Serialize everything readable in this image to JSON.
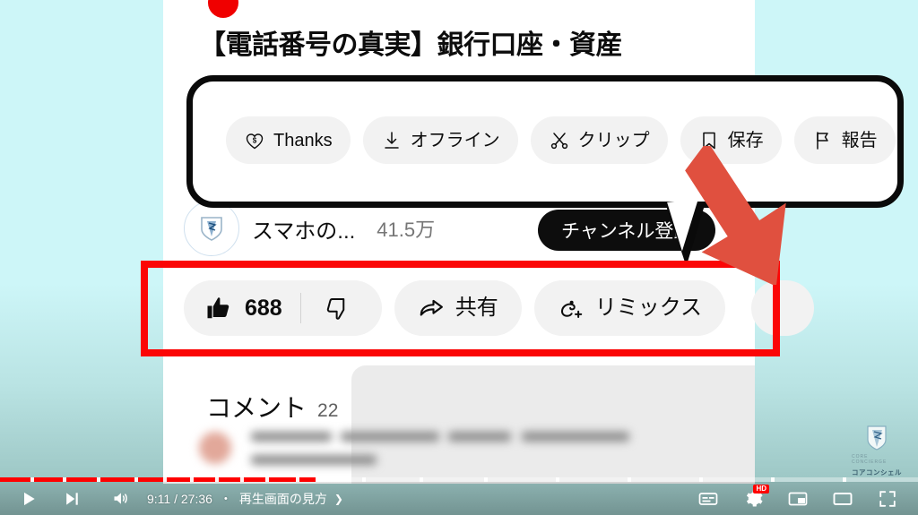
{
  "video": {
    "title": "【電話番号の真実】銀行口座・資産",
    "top_dot_color": "#f00000"
  },
  "action_chips": [
    {
      "label": "Thanks",
      "icon": "heart-dollar-icon"
    },
    {
      "label": "オフライン",
      "icon": "download-icon"
    },
    {
      "label": "クリップ",
      "icon": "scissors-icon"
    },
    {
      "label": "保存",
      "icon": "bookmark-icon"
    },
    {
      "label": "報告",
      "icon": "flag-icon"
    }
  ],
  "channel": {
    "name": "スマホの...",
    "subscribers": "41.5万",
    "subscribe_label": "チャンネル登録"
  },
  "engagement": {
    "like_count": "688",
    "like_icon": "thumbs-up-icon",
    "dislike_icon": "thumbs-down-icon",
    "share_label": "共有",
    "share_icon": "share-arrow-icon",
    "remix_label": "リミックス",
    "remix_icon": "remix-icon"
  },
  "comments": {
    "title": "コメント",
    "count": "22"
  },
  "watermark": {
    "sub": "CORE CONCIERGE",
    "name": "コアコンシェル"
  },
  "player": {
    "time": "9:11 / 27:36",
    "separator": "・",
    "chapter": "再生画面の見方",
    "chapter_chevron": "❯",
    "play_icon": "play-icon",
    "next_icon": "next-track-icon",
    "volume_icon": "volume-icon",
    "subtitles_icon": "subtitles-icon",
    "settings_icon": "gear-icon",
    "quality_badge": "HD",
    "miniplayer_icon": "miniplayer-icon",
    "theater_icon": "theater-mode-icon",
    "fullscreen_icon": "fullscreen-icon",
    "progress_percent": 34,
    "progress_color": "#ff0000"
  },
  "annotations": {
    "callout_border_color": "#0a0a0a",
    "highlight_rect_color": "#fb0606",
    "arrow_color": "#e0503f"
  }
}
